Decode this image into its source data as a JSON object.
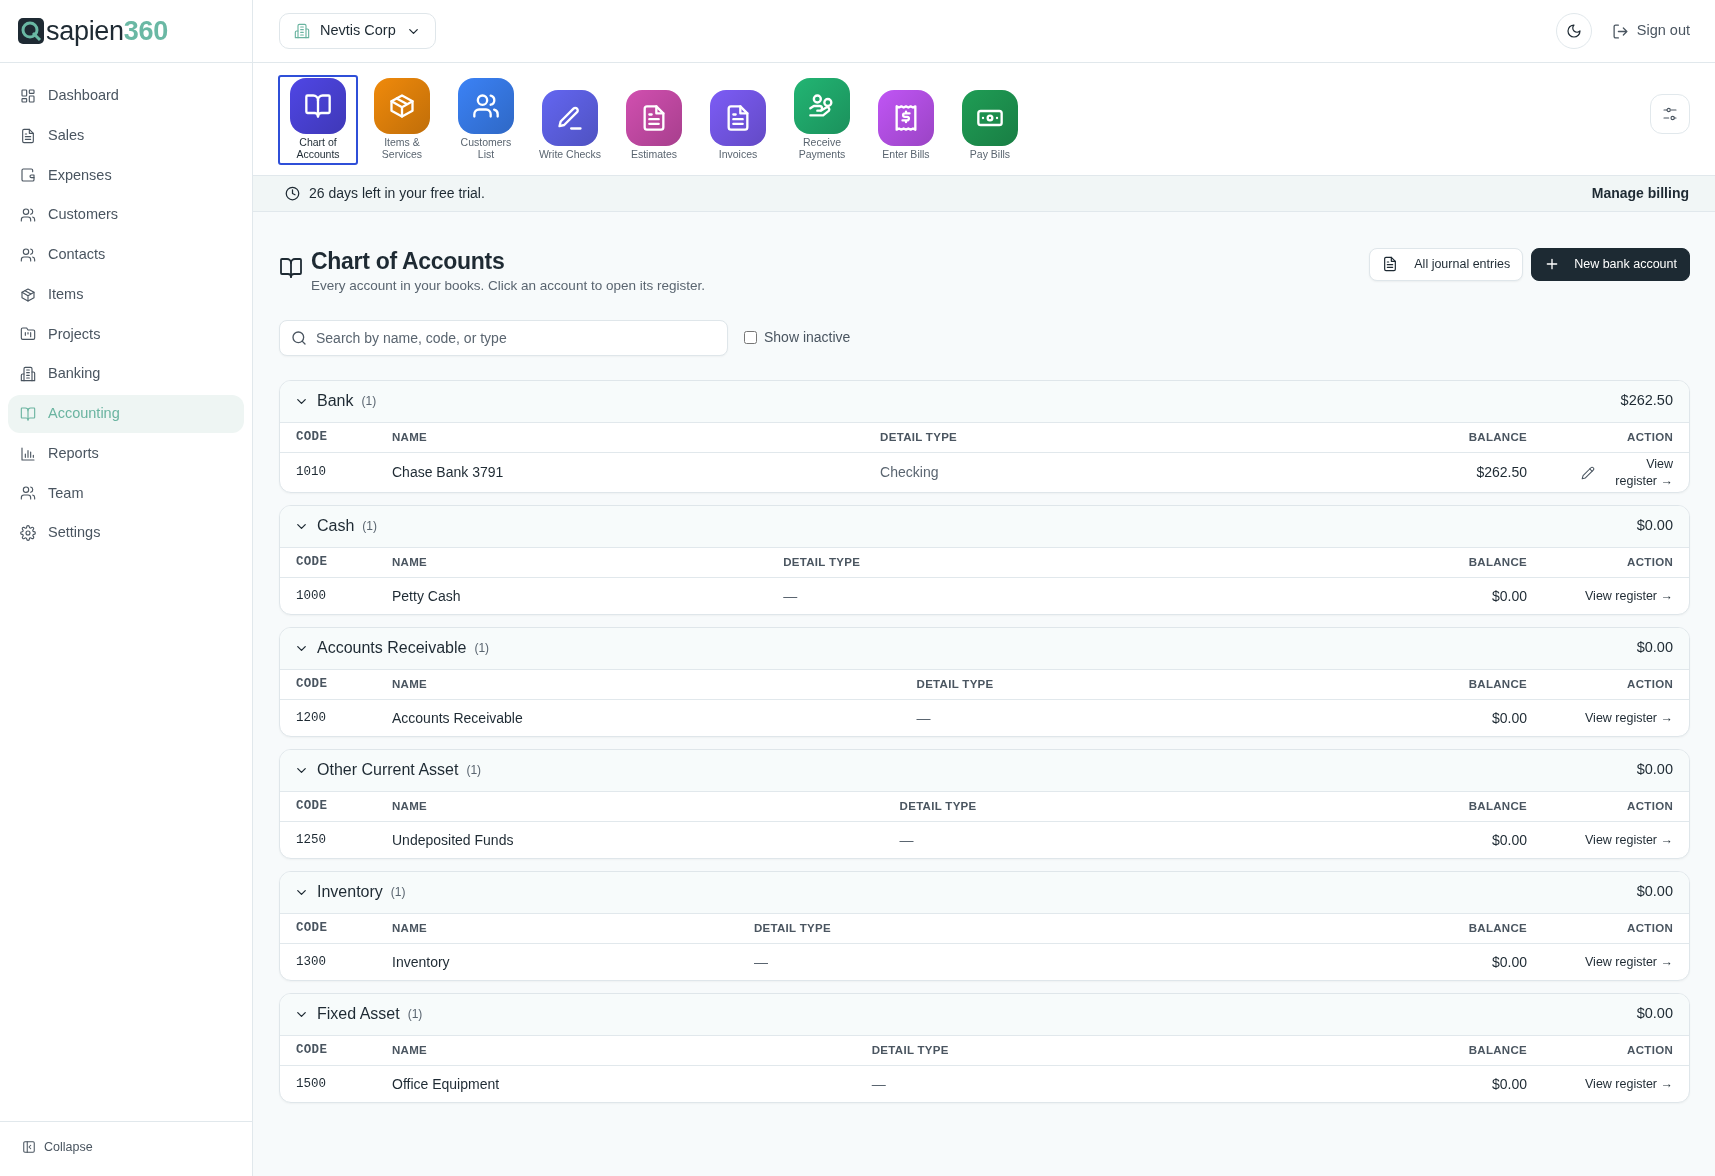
{
  "brand": {
    "name": "sapien",
    "suffix": "360"
  },
  "sidebar": {
    "items": [
      {
        "label": "Dashboard",
        "selected": false
      },
      {
        "label": "Sales",
        "selected": false
      },
      {
        "label": "Expenses",
        "selected": false
      },
      {
        "label": "Customers",
        "selected": false
      },
      {
        "label": "Contacts",
        "selected": false
      },
      {
        "label": "Items",
        "selected": false
      },
      {
        "label": "Projects",
        "selected": false
      },
      {
        "label": "Banking",
        "selected": false
      },
      {
        "label": "Accounting",
        "selected": true
      },
      {
        "label": "Reports",
        "selected": false
      },
      {
        "label": "Team",
        "selected": false
      },
      {
        "label": "Settings",
        "selected": false
      }
    ],
    "collapse": "Collapse"
  },
  "header": {
    "company": "Nevtis Corp",
    "sign_out": "Sign out"
  },
  "toolbar": {
    "items": [
      {
        "label": "Chart of\nAccounts",
        "color": "#4f46e5",
        "selected": true
      },
      {
        "label": "Items &\nServices",
        "color": "#f08a0b",
        "selected": false
      },
      {
        "label": "Customers\nList",
        "color": "#3b82f6",
        "selected": false
      },
      {
        "label": "Write Checks",
        "color": "#6366f1",
        "selected": false
      },
      {
        "label": "Estimates",
        "color": "#d14fb0",
        "selected": false
      },
      {
        "label": "Invoices",
        "color": "#7c5cf6",
        "selected": false
      },
      {
        "label": "Receive\nPayments",
        "color": "#22b573",
        "selected": false
      },
      {
        "label": "Enter Bills",
        "color": "#c055f5",
        "selected": false
      },
      {
        "label": "Pay Bills",
        "color": "#1f9d55",
        "selected": false
      }
    ]
  },
  "trial": {
    "message": "26 days left in your free trial.",
    "link": "Manage billing"
  },
  "page": {
    "title": "Chart of Accounts",
    "subtitle": "Every account in your books. Click an account to open its register.",
    "buttons": [
      {
        "label": "All journal entries",
        "kind": "secondary"
      },
      {
        "label": "New bank account",
        "kind": "primary"
      }
    ],
    "search": {
      "placeholder": "Search by name, code, or type"
    },
    "show_inactive": {
      "label": "Show inactive",
      "checked": false
    }
  },
  "groups": [
    {
      "name": "Bank",
      "count": "(1)",
      "total": "$262.50",
      "expanded": true,
      "columns": [
        "CODE",
        "NAME",
        "DETAIL TYPE",
        "BALANCE",
        "ACTION"
      ],
      "rows": [
        {
          "code": "1010",
          "name": "Chase Bank 3791",
          "detail_type": "Checking",
          "balance": "$262.50",
          "action": "View register →",
          "editable": true
        }
      ]
    },
    {
      "name": "Cash",
      "count": "(1)",
      "total": "$0.00",
      "expanded": true,
      "columns": [
        "CODE",
        "NAME",
        "DETAIL TYPE",
        "BALANCE",
        "ACTION"
      ],
      "rows": [
        {
          "code": "1000",
          "name": "Petty Cash",
          "detail_type": "—",
          "balance": "$0.00",
          "action": "View register →",
          "editable": false
        }
      ]
    },
    {
      "name": "Accounts Receivable",
      "count": "(1)",
      "total": "$0.00",
      "expanded": true,
      "columns": [
        "CODE",
        "NAME",
        "DETAIL TYPE",
        "BALANCE",
        "ACTION"
      ],
      "rows": [
        {
          "code": "1200",
          "name": "Accounts Receivable",
          "detail_type": "—",
          "balance": "$0.00",
          "action": "View register →",
          "editable": false
        }
      ]
    },
    {
      "name": "Other Current Asset",
      "count": "(1)",
      "total": "$0.00",
      "expanded": true,
      "columns": [
        "CODE",
        "NAME",
        "DETAIL TYPE",
        "BALANCE",
        "ACTION"
      ],
      "rows": [
        {
          "code": "1250",
          "name": "Undeposited Funds",
          "detail_type": "—",
          "balance": "$0.00",
          "action": "View register →",
          "editable": false
        }
      ]
    },
    {
      "name": "Inventory",
      "count": "(1)",
      "total": "$0.00",
      "expanded": true,
      "columns": [
        "CODE",
        "NAME",
        "DETAIL TYPE",
        "BALANCE",
        "ACTION"
      ],
      "rows": [
        {
          "code": "1300",
          "name": "Inventory",
          "detail_type": "—",
          "balance": "$0.00",
          "action": "View register →",
          "editable": false
        }
      ]
    },
    {
      "name": "Fixed Asset",
      "count": "(1)",
      "total": "$0.00",
      "expanded": true,
      "columns": [
        "CODE",
        "NAME",
        "DETAIL TYPE",
        "BALANCE",
        "ACTION"
      ],
      "rows": [
        {
          "code": "1500",
          "name": "Office Equipment",
          "detail_type": "—",
          "balance": "$0.00",
          "action": "View register →",
          "editable": false
        }
      ]
    }
  ]
}
